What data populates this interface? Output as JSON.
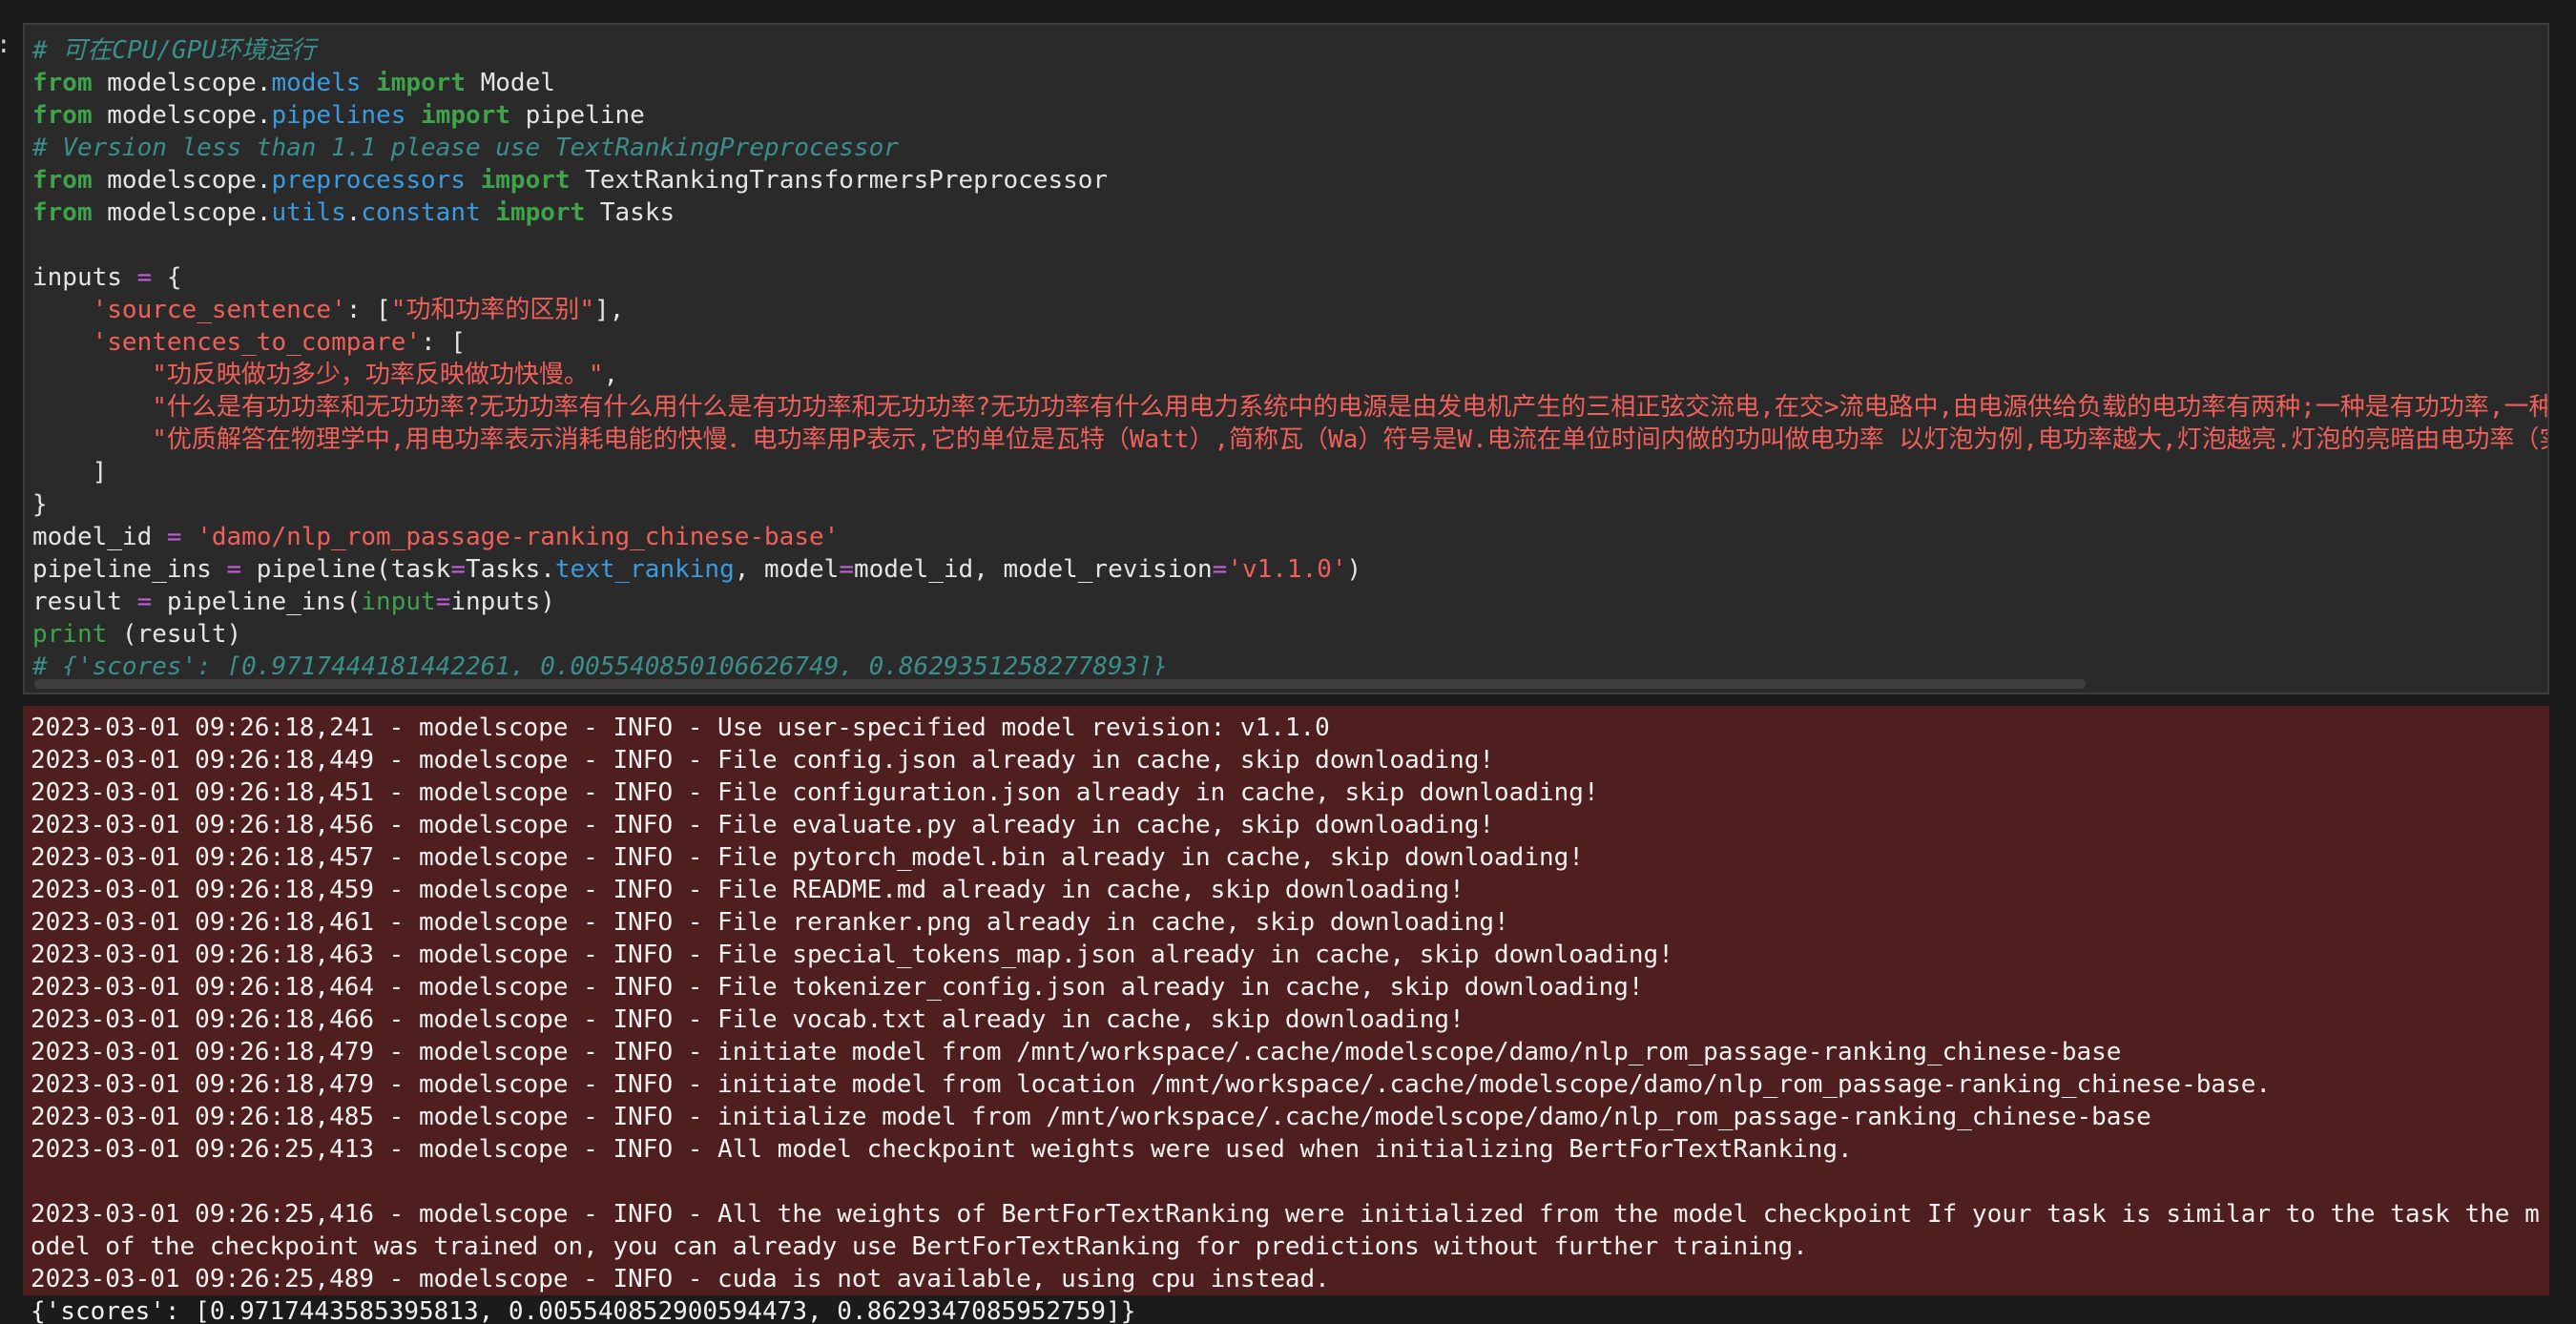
{
  "prompt_marker": ":",
  "code": {
    "lines": [
      [
        {
          "t": "# 可在CPU/GPU环境运行",
          "c": "cmt"
        }
      ],
      [
        {
          "t": "from",
          "c": "kw"
        },
        {
          "t": " modelscope.",
          "c": "plain"
        },
        {
          "t": "models",
          "c": "mod"
        },
        {
          "t": " ",
          "c": "plain"
        },
        {
          "t": "import",
          "c": "kw"
        },
        {
          "t": " Model",
          "c": "plain"
        }
      ],
      [
        {
          "t": "from",
          "c": "kw"
        },
        {
          "t": " modelscope.",
          "c": "plain"
        },
        {
          "t": "pipelines",
          "c": "mod"
        },
        {
          "t": " ",
          "c": "plain"
        },
        {
          "t": "import",
          "c": "kw"
        },
        {
          "t": " pipeline",
          "c": "plain"
        }
      ],
      [
        {
          "t": "# Version less than 1.1 please use TextRankingPreprocessor",
          "c": "cmt"
        }
      ],
      [
        {
          "t": "from",
          "c": "kw"
        },
        {
          "t": " modelscope.",
          "c": "plain"
        },
        {
          "t": "preprocessors",
          "c": "mod"
        },
        {
          "t": " ",
          "c": "plain"
        },
        {
          "t": "import",
          "c": "kw"
        },
        {
          "t": " TextRankingTransformersPreprocessor",
          "c": "plain"
        }
      ],
      [
        {
          "t": "from",
          "c": "kw"
        },
        {
          "t": " modelscope.",
          "c": "plain"
        },
        {
          "t": "utils",
          "c": "mod"
        },
        {
          "t": ".",
          "c": "plain"
        },
        {
          "t": "constant",
          "c": "mod"
        },
        {
          "t": " ",
          "c": "plain"
        },
        {
          "t": "import",
          "c": "kw"
        },
        {
          "t": " Tasks",
          "c": "plain"
        }
      ],
      [],
      [
        {
          "t": "inputs ",
          "c": "plain"
        },
        {
          "t": "=",
          "c": "op"
        },
        {
          "t": " {",
          "c": "plain"
        }
      ],
      [
        {
          "t": "    ",
          "c": "plain"
        },
        {
          "t": "'source_sentence'",
          "c": "str"
        },
        {
          "t": ": [",
          "c": "plain"
        },
        {
          "t": "\"功和功率的区别\"",
          "c": "str"
        },
        {
          "t": "],",
          "c": "plain"
        }
      ],
      [
        {
          "t": "    ",
          "c": "plain"
        },
        {
          "t": "'sentences_to_compare'",
          "c": "str"
        },
        {
          "t": ": [",
          "c": "plain"
        }
      ],
      [
        {
          "t": "        ",
          "c": "plain"
        },
        {
          "t": "\"功反映做功多少，功率反映做功快慢。\"",
          "c": "str"
        },
        {
          "t": ",",
          "c": "plain"
        }
      ],
      [
        {
          "t": "        ",
          "c": "plain"
        },
        {
          "t": "\"什么是有功功率和无功功率?无功功率有什么用什么是有功功率和无功功率?无功功率有什么用电力系统中的电源是由发电机产生的三相正弦交流电,在交>流电路中,由电源供给负载的电功率有两种;一种是有功功率,一种",
          "c": "str"
        }
      ],
      [
        {
          "t": "        ",
          "c": "plain"
        },
        {
          "t": "\"优质解答在物理学中,用电功率表示消耗电能的快慢．电功率用P表示,它的单位是瓦特（Watt）,简称瓦（Wa）符号是W.电流在单位时间内做的功叫做电功率 以灯泡为例,电功率越大,灯泡越亮.灯泡的亮暗由电功率（实",
          "c": "str"
        }
      ],
      [
        {
          "t": "    ]",
          "c": "plain"
        }
      ],
      [
        {
          "t": "}",
          "c": "plain"
        }
      ],
      [
        {
          "t": "model_id ",
          "c": "plain"
        },
        {
          "t": "=",
          "c": "op"
        },
        {
          "t": " ",
          "c": "plain"
        },
        {
          "t": "'damo/nlp_rom_passage-ranking_chinese-base'",
          "c": "str"
        }
      ],
      [
        {
          "t": "pipeline_ins ",
          "c": "plain"
        },
        {
          "t": "=",
          "c": "op"
        },
        {
          "t": " pipeline(task",
          "c": "plain"
        },
        {
          "t": "=",
          "c": "op"
        },
        {
          "t": "Tasks.",
          "c": "plain"
        },
        {
          "t": "text_ranking",
          "c": "mod"
        },
        {
          "t": ", model",
          "c": "plain"
        },
        {
          "t": "=",
          "c": "op"
        },
        {
          "t": "model_id, model_revision",
          "c": "plain"
        },
        {
          "t": "=",
          "c": "op"
        },
        {
          "t": "'v1.1.0'",
          "c": "str"
        },
        {
          "t": ")",
          "c": "plain"
        }
      ],
      [
        {
          "t": "result ",
          "c": "plain"
        },
        {
          "t": "=",
          "c": "op"
        },
        {
          "t": " pipeline_ins(",
          "c": "plain"
        },
        {
          "t": "input",
          "c": "param"
        },
        {
          "t": "=",
          "c": "op"
        },
        {
          "t": "inputs)",
          "c": "plain"
        }
      ],
      [
        {
          "t": "print",
          "c": "builtin"
        },
        {
          "t": " (result)",
          "c": "plain"
        }
      ],
      [
        {
          "t": "# {'scores': [0.9717444181442261, 0.005540850106626749, 0.8629351258277893]}",
          "c": "cmt"
        }
      ]
    ]
  },
  "stderr": {
    "lines": [
      "2023-03-01 09:26:18,241 - modelscope - INFO - Use user-specified model revision: v1.1.0",
      "2023-03-01 09:26:18,449 - modelscope - INFO - File config.json already in cache, skip downloading!",
      "2023-03-01 09:26:18,451 - modelscope - INFO - File configuration.json already in cache, skip downloading!",
      "2023-03-01 09:26:18,456 - modelscope - INFO - File evaluate.py already in cache, skip downloading!",
      "2023-03-01 09:26:18,457 - modelscope - INFO - File pytorch_model.bin already in cache, skip downloading!",
      "2023-03-01 09:26:18,459 - modelscope - INFO - File README.md already in cache, skip downloading!",
      "2023-03-01 09:26:18,461 - modelscope - INFO - File reranker.png already in cache, skip downloading!",
      "2023-03-01 09:26:18,463 - modelscope - INFO - File special_tokens_map.json already in cache, skip downloading!",
      "2023-03-01 09:26:18,464 - modelscope - INFO - File tokenizer_config.json already in cache, skip downloading!",
      "2023-03-01 09:26:18,466 - modelscope - INFO - File vocab.txt already in cache, skip downloading!",
      "2023-03-01 09:26:18,479 - modelscope - INFO - initiate model from /mnt/workspace/.cache/modelscope/damo/nlp_rom_passage-ranking_chinese-base",
      "2023-03-01 09:26:18,479 - modelscope - INFO - initiate model from location /mnt/workspace/.cache/modelscope/damo/nlp_rom_passage-ranking_chinese-base.",
      "2023-03-01 09:26:18,485 - modelscope - INFO - initialize model from /mnt/workspace/.cache/modelscope/damo/nlp_rom_passage-ranking_chinese-base",
      "2023-03-01 09:26:25,413 - modelscope - INFO - All model checkpoint weights were used when initializing BertForTextRanking.",
      "",
      "2023-03-01 09:26:25,416 - modelscope - INFO - All the weights of BertForTextRanking were initialized from the model checkpoint If your task is similar to the task the m",
      "odel of the checkpoint was trained on, you can already use BertForTextRanking for predictions without further training.",
      "2023-03-01 09:26:25,489 - modelscope - INFO - cuda is not available, using cpu instead."
    ]
  },
  "stdout": {
    "text": "{'scores': [0.9717443585395813, 0.005540852900594473, 0.8629347085952759]}"
  }
}
